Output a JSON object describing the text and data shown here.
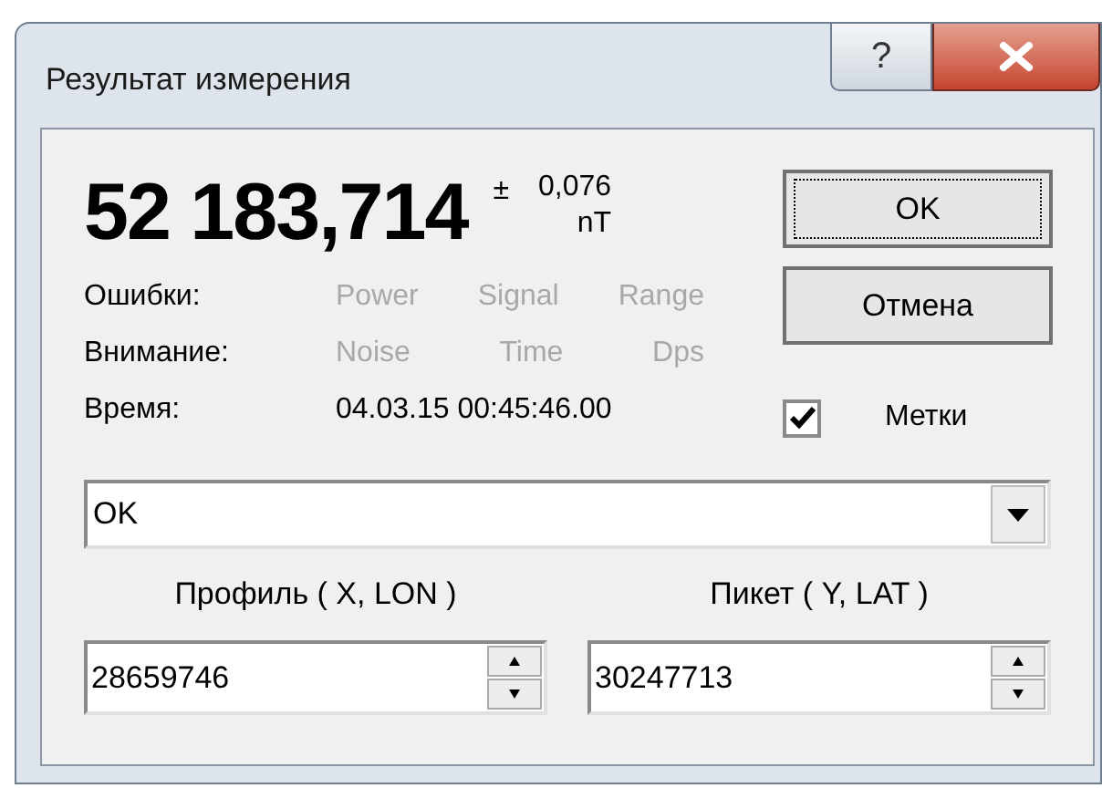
{
  "window": {
    "title": "Результат измерения",
    "help_button": "?"
  },
  "measurement": {
    "value": "52 183,714",
    "plus_minus": "±",
    "error": "0,076",
    "unit": "nT"
  },
  "buttons": [
    {
      "label": "OK",
      "focused": true
    },
    {
      "label": "Отмена",
      "focused": false
    }
  ],
  "status_rows": [
    {
      "label": "Ошибки:",
      "flags": [
        {
          "label": "Power",
          "active": false
        },
        {
          "label": "Signal",
          "active": false
        },
        {
          "label": "Range",
          "active": false
        }
      ]
    },
    {
      "label": "Внимание:",
      "flags": [
        {
          "label": "Noise",
          "active": false
        },
        {
          "label": "Time",
          "active": false
        },
        {
          "label": "Dps",
          "active": false
        }
      ]
    }
  ],
  "time": {
    "label": "Время:",
    "value": "04.03.15 00:45:46.00"
  },
  "marks_checkbox": {
    "label": "Метки",
    "checked": true
  },
  "status_combo": {
    "value": "OK"
  },
  "fields": [
    {
      "label": "Профиль ( X, LON )",
      "value": "28659746"
    },
    {
      "label": "Пикет ( Y, LAT )",
      "value": "30247713"
    }
  ]
}
